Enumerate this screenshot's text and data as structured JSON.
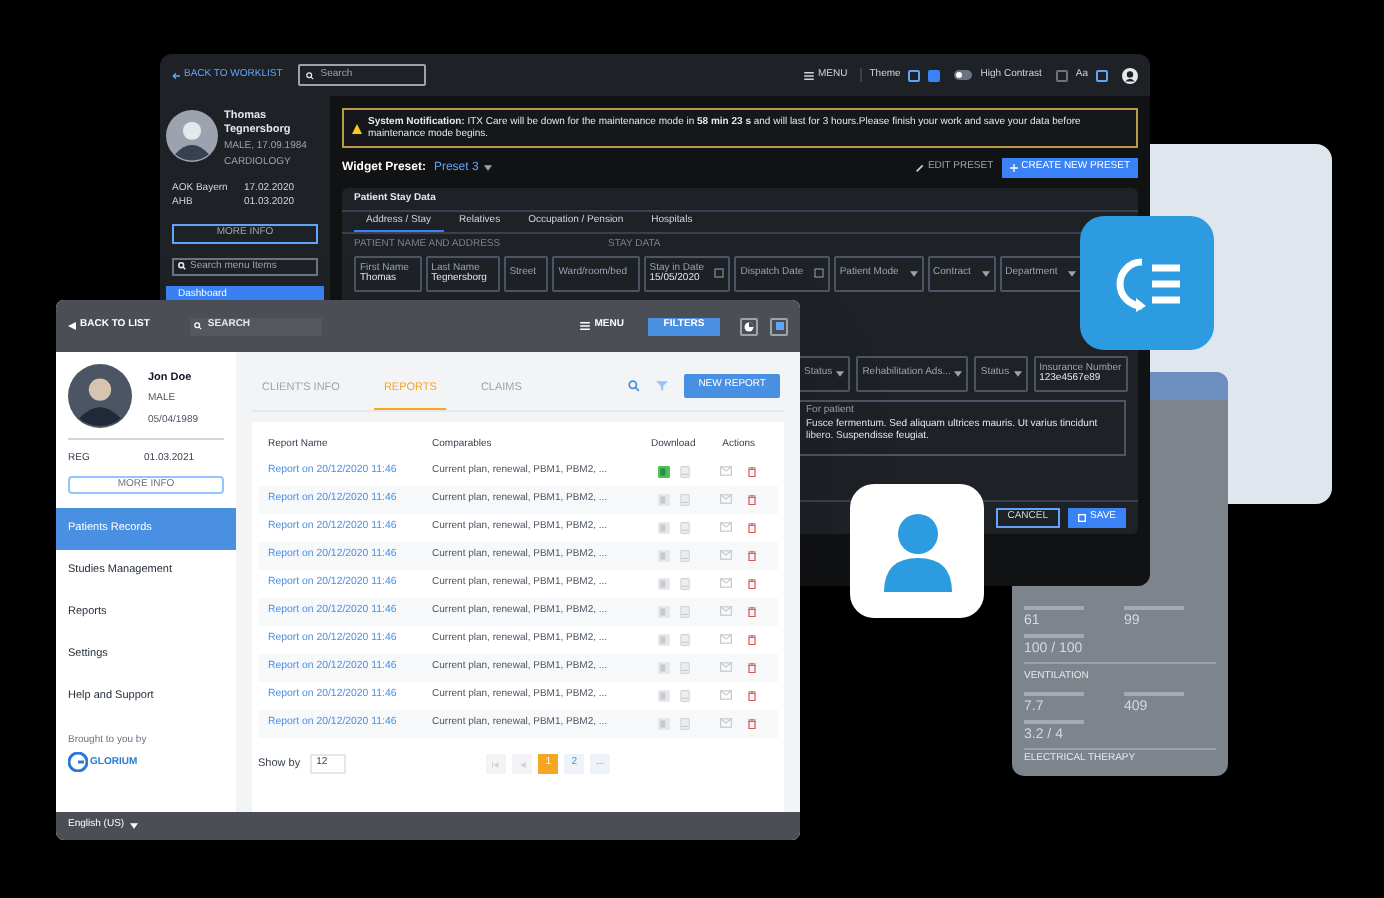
{
  "back_window": {
    "topbar": {
      "back": "BACK TO WORKLIST",
      "search_placeholder": "Search",
      "menu": "MENU",
      "theme": "Theme",
      "high_contrast": "High Contrast",
      "high_contrast_on": false,
      "font_size": "Aa"
    },
    "patient": {
      "name": "Thomas Tegnersborg",
      "info": "MALE, 17.09.1984",
      "department": "CARDIOLOGY",
      "insurance": [
        {
          "label": "AOK Bayern",
          "value": "17.02.2020"
        },
        {
          "label": "AHB",
          "value": "01.03.2020"
        }
      ],
      "more_info": "MORE INFO",
      "menu_search_placeholder": "Search menu Items",
      "nav": [
        {
          "label": "Dashboard",
          "selected": true
        }
      ]
    },
    "notification": {
      "title": "System Notification:",
      "text": "ITX Care will be down for the maintenance mode in **58 min 23 s** and will last for 3 hours.Please finish your work and save your data before maintenance mode begins."
    },
    "preset": {
      "label": "Widget Preset:",
      "value": "Preset 3",
      "edit": "EDIT PRESET",
      "create": "CREATE NEW PRESET"
    },
    "panel": {
      "title": "Patient Stay Data",
      "tabs": [
        {
          "label": "Address / Stay",
          "selected": true
        },
        {
          "label": "Relatives",
          "selected": false
        },
        {
          "label": "Occupation / Pension",
          "selected": false
        },
        {
          "label": "Hospitals",
          "selected": false
        }
      ],
      "sections": [
        "PATIENT NAME AND ADDRESS",
        "STAY DATA"
      ],
      "fields_row1": [
        {
          "kind": "text",
          "label": "First Name",
          "value": "Thomas"
        },
        {
          "kind": "text",
          "label": "Last Name",
          "value": "Tegnersborg"
        },
        {
          "kind": "text",
          "placeholder": "Street"
        },
        {
          "kind": "text",
          "placeholder": "Ward/room/bed"
        },
        {
          "kind": "date",
          "label": "Stay in Date",
          "value": "15/05/2020"
        },
        {
          "kind": "date",
          "placeholder": "Dispatch Date"
        },
        {
          "kind": "select",
          "placeholder": "Patient Mode"
        },
        {
          "kind": "select",
          "placeholder": "Contract"
        },
        {
          "kind": "select",
          "placeholder": "Department"
        }
      ],
      "fields_row2": [
        {
          "kind": "select",
          "placeholder": "Status"
        },
        {
          "kind": "select",
          "placeholder": "Rehabilitation Ads..."
        },
        {
          "kind": "select",
          "placeholder": "Status"
        },
        {
          "kind": "text",
          "label": "Insurance Number",
          "value": "123e4567e89"
        }
      ],
      "note": {
        "label": "For patient",
        "value": "Fusce fermentum. Sed aliquam ultrices mauris. Ut varius tincidunt libero. Suspendisse feugiat."
      },
      "cancel": "CANCEL",
      "save": "SAVE"
    }
  },
  "front_window": {
    "topbar": {
      "back": "BACK TO LIST",
      "search": "SEARCH",
      "menu": "MENU",
      "filters": "FILTERS"
    },
    "patient": {
      "name": "Jon Doe",
      "gender": "MALE",
      "birth_date": "05/04/1989",
      "reg_label": "REG",
      "reg_value": "01.03.2021",
      "more_info": "MORE INFO"
    },
    "nav": [
      {
        "label": "Patients Records",
        "selected": true
      },
      {
        "label": "Studies Management",
        "selected": false
      },
      {
        "label": "Reports",
        "selected": false
      },
      {
        "label": "Settings",
        "selected": false
      },
      {
        "label": "Help and Support",
        "selected": false
      }
    ],
    "brought_by": "Brought to you by",
    "logo": "GLORIUM",
    "language": "English (US)",
    "tabs": [
      {
        "label": "CLIENT'S INFO",
        "selected": false
      },
      {
        "label": "REPORTS",
        "selected": true
      },
      {
        "label": "CLAIMS",
        "selected": false
      }
    ],
    "new_report": "NEW REPORT",
    "table": {
      "columns": [
        "Report Name",
        "Comparables",
        "Download",
        "Actions"
      ],
      "rows": [
        {
          "name": "Report on 20/12/2020 11:46",
          "comparables": "Current plan, renewal, PBM1, PBM2, ...",
          "download_ready": true
        },
        {
          "name": "Report on 20/12/2020 11:46",
          "comparables": "Current plan, renewal, PBM1, PBM2, ...",
          "download_ready": false
        },
        {
          "name": "Report on 20/12/2020 11:46",
          "comparables": "Current plan, renewal, PBM1, PBM2, ...",
          "download_ready": false
        },
        {
          "name": "Report on 20/12/2020 11:46",
          "comparables": "Current plan, renewal, PBM1, PBM2, ...",
          "download_ready": false
        },
        {
          "name": "Report on 20/12/2020 11:46",
          "comparables": "Current plan, renewal, PBM1, PBM2, ...",
          "download_ready": false
        },
        {
          "name": "Report on 20/12/2020 11:46",
          "comparables": "Current plan, renewal, PBM1, PBM2, ...",
          "download_ready": false
        },
        {
          "name": "Report on 20/12/2020 11:46",
          "comparables": "Current plan, renewal, PBM1, PBM2, ...",
          "download_ready": false
        },
        {
          "name": "Report on 20/12/2020 11:46",
          "comparables": "Current plan, renewal, PBM1, PBM2, ...",
          "download_ready": false
        },
        {
          "name": "Report on 20/12/2020 11:46",
          "comparables": "Current plan, renewal, PBM1, PBM2, ...",
          "download_ready": false
        },
        {
          "name": "Report on 20/12/2020 11:46",
          "comparables": "Current plan, renewal, PBM1, PBM2, ...",
          "download_ready": false
        }
      ]
    },
    "show_by": "Show by",
    "page_size": "12",
    "pages": [
      {
        "label": "1",
        "selected": true
      },
      {
        "label": "2",
        "selected": false
      },
      {
        "label": "...",
        "selected": false
      }
    ]
  },
  "phone": {
    "values": [
      "61",
      "99",
      "100 / 100"
    ],
    "section": "VENTILATION",
    "values2": [
      "7.7",
      "409",
      "3.2 / 4"
    ],
    "section2": "ELECTRICAL THERAPY"
  }
}
